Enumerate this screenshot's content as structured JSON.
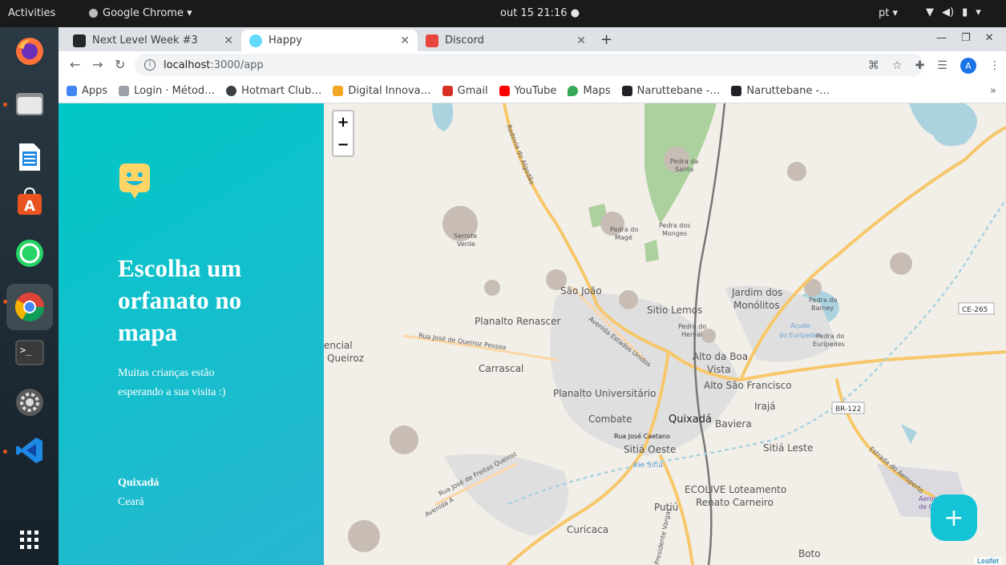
{
  "top_panel": {
    "activities": "Activities",
    "app_name": "Google Chrome ▾",
    "clock": "out 15  21:16  ●",
    "lang": "pt ▾",
    "sys_icons": [
      "wifi-icon",
      "volume-icon",
      "battery-icon",
      "chevron-down-icon"
    ]
  },
  "dock": {
    "items": [
      "firefox-icon",
      "files-icon",
      "writer-icon",
      "software-center-icon",
      "whatsapp-icon",
      "chrome-icon",
      "terminal-icon",
      "settings-icon",
      "vscode-icon"
    ],
    "apps_grid_icon": "apps-grid-icon"
  },
  "browser": {
    "tabs": [
      {
        "title": "Next Level Week #3",
        "color": "#23272a"
      },
      {
        "title": "Happy",
        "color": "#61dafb"
      },
      {
        "title": "Discord",
        "color": "#e8463c"
      }
    ],
    "new_tab": "+",
    "url_host": "localhost",
    "url_path": ":3000/app",
    "bookmarks": [
      {
        "label": "Apps",
        "color": "#4285f4"
      },
      {
        "label": "Login · Métod…",
        "color": "#9aa0a6"
      },
      {
        "label": "Hotmart Club…",
        "color": "#3c4043"
      },
      {
        "label": "Digital Innova…",
        "color": "#f5a623"
      },
      {
        "label": "Gmail",
        "color": "#d93025"
      },
      {
        "label": "YouTube",
        "color": "#ff0000"
      },
      {
        "label": "Maps",
        "color": "#34a853"
      },
      {
        "label": "Naruttebane -…",
        "color": "#202124"
      },
      {
        "label": "Naruttebane -…",
        "color": "#202124"
      }
    ],
    "bookmarks_more": "»",
    "avatar": "A"
  },
  "app": {
    "headline": "Escolha um orfanato no mapa",
    "subtitle": "Muitas crianças estão esperando a sua visita :)",
    "city": "Quixadá",
    "state": "Ceará",
    "zoom_in": "+",
    "zoom_out": "−",
    "add_button": "+",
    "attribution": "Leaflet",
    "accent_color": "#15c3d6"
  },
  "map_labels": {
    "quixada": "Quixadá",
    "pedra_santa": "Pedra da",
    "santa": "Santa",
    "pedra_mage": "Pedra do",
    "mage": "Magé",
    "pedra_monges": "Pedra dos",
    "monges": "Monges",
    "serrote": "Serrote",
    "verde": "Verde",
    "sao_joao": "São João",
    "planalto_renascer": "Planalto Renascer",
    "sitio_lemos": "Sitio Lemos",
    "jardim_dos": "Jardim dos",
    "monolitos": "Monólitos",
    "ce265": "CE-265",
    "carrascal": "Carrascal",
    "alto_boa": "Alto da Boa",
    "vista": "Vista",
    "planalto_univ": "Planalto Universitário",
    "alto_sf": "Alto São Francisco",
    "combate": "Combate",
    "iraja": "Irajá",
    "baviera": "Baviera",
    "br122": "BR-122",
    "sitia_oeste": "Sitiá Oeste",
    "sitia_leste": "Sitiá Leste",
    "ecolive": "ECOLIVE Loteamento",
    "renato": "Renato Carneiro",
    "putiu": "Putiú",
    "curicaca": "Curicaca",
    "boto": "Boto",
    "encial": "encial",
    "queiroz": "Queiroz",
    "rua_jose": "Rua José de Queiroz Pessoa",
    "av_estados": "Avenida Estados Unidos",
    "rodovia": "Rodovia do Algodão",
    "rua_caetano": "Rua José Caetano",
    "rio_sitia": "Rio Sitiá",
    "estrada": "Estrada do Aeroporto",
    "aeroporto": "Aeropo",
    "de_qui": "de Qui",
    "acude": "Açude",
    "do_euripedes": "do Eurípedes",
    "pedra_barney": "Pedra do",
    "barney": "Barney",
    "pedra_eur": "Pedra do",
    "euripedes": "Eurípedes",
    "pedra_herval": "Pedra do",
    "herval": "Herval",
    "freitas": "Rua José de Freitas Queiroz",
    "avenida_a": "Avenida A",
    "presidente": "Presidente Vargas"
  }
}
